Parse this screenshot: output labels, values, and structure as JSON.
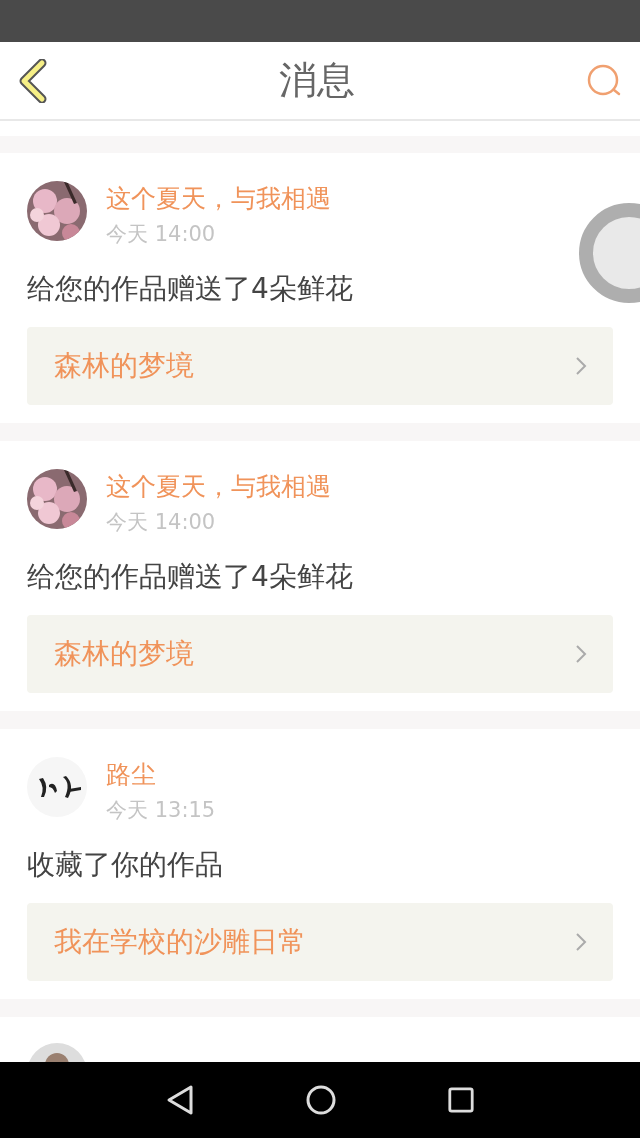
{
  "header": {
    "title": "消息"
  },
  "messages": [
    {
      "name": "这个夏天，与我相遇",
      "time": "今天 14:00",
      "text": "给您的作品赠送了4朵鲜花",
      "work": "森林的梦境"
    },
    {
      "name": "这个夏天，与我相遇",
      "time": "今天 14:00",
      "text": "给您的作品赠送了4朵鲜花",
      "work": "森林的梦境"
    },
    {
      "name": "路尘",
      "time": "今天 13:15",
      "text": "收藏了你的作品",
      "work": "我在学校的沙雕日常"
    }
  ]
}
